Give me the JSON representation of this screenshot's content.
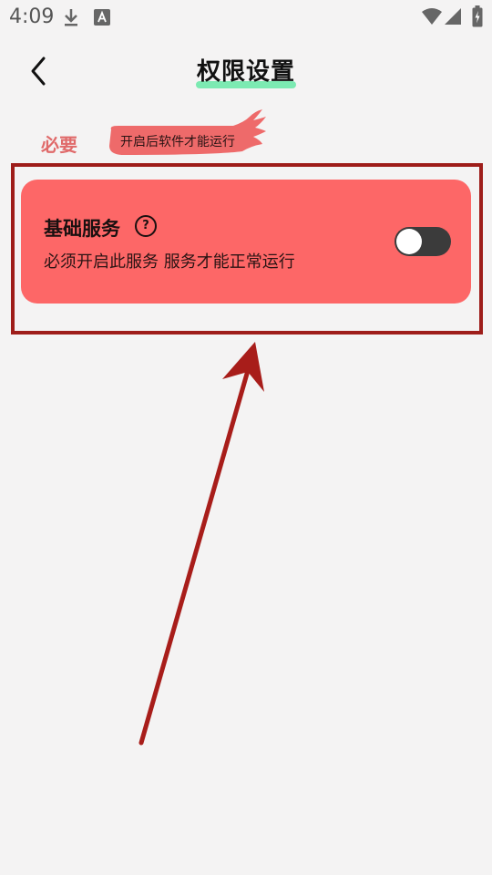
{
  "status_bar": {
    "time": "4:09",
    "icons": [
      "download-icon",
      "app-a-icon",
      "wifi-icon",
      "signal-icon",
      "battery-icon"
    ]
  },
  "header": {
    "title": "权限设置",
    "back_icon": "chevron-left-icon"
  },
  "section": {
    "label": "必要",
    "tag": "开启后软件才能运行"
  },
  "service": {
    "title": "基础服务",
    "help_symbol": "?",
    "description": "必须开启此服务 服务才能正常运行",
    "toggle_on": false
  },
  "colors": {
    "card": "#fd6767",
    "highlight": "#9e1d1a",
    "section_label": "#e06a6a",
    "title_underline": "#66e8a6"
  }
}
